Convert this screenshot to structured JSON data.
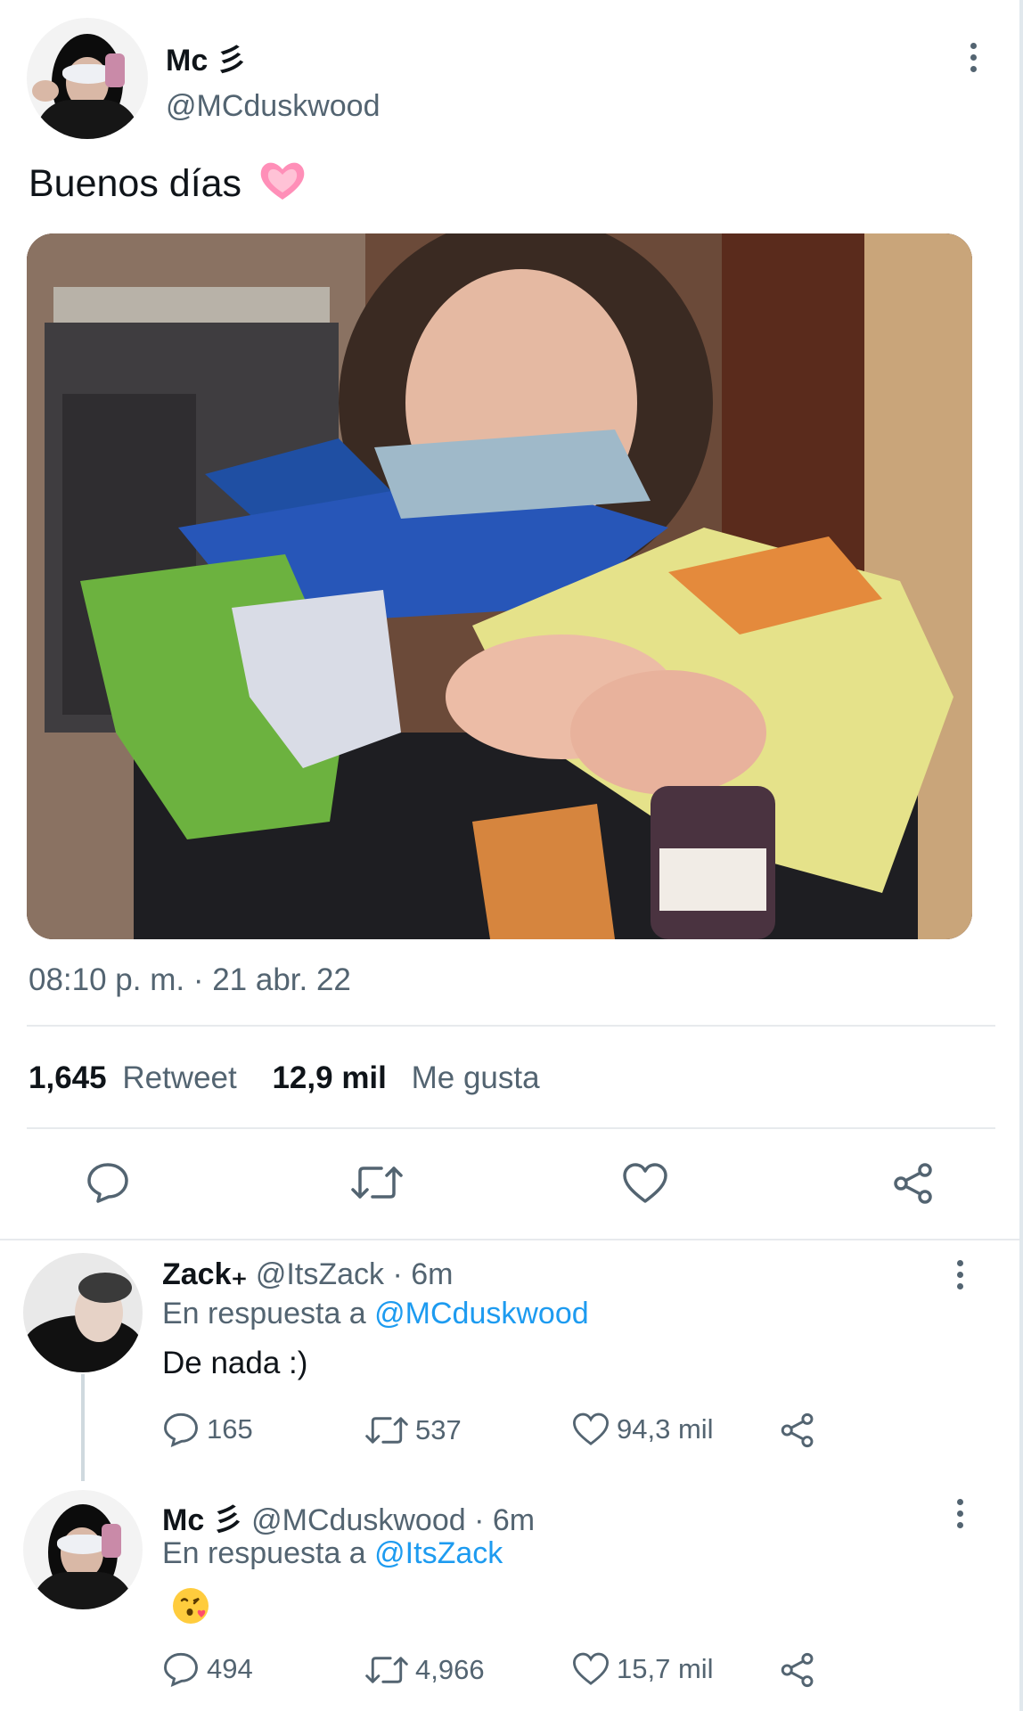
{
  "tweet": {
    "author_name": "Mc",
    "author_symbol": "彡",
    "author_handle": "@MCduskwood",
    "text": "Buenos días",
    "timestamp": "08:10 p. m. · 21 abr. 22",
    "retweet_count": "1,645",
    "retweet_label": "Retweet",
    "like_count": "12,9 mil",
    "like_label": "Me gusta"
  },
  "replies": [
    {
      "name": "Zack",
      "name_suffix": "₊",
      "handle": "@ItsZack",
      "time": "· 6m",
      "in_reply_label": "En respuesta a",
      "in_reply_to": "@MCduskwood",
      "text": "De nada :)",
      "reply_count": "165",
      "retweet_count": "537",
      "like_count": "94,3 mil"
    },
    {
      "name": "Mc",
      "name_suffix": "彡",
      "handle": "@MCduskwood",
      "time": "· 6m",
      "in_reply_label": "En respuesta a",
      "in_reply_to": "@ItsZack",
      "text": "😘",
      "reply_count": "494",
      "retweet_count": "4,966",
      "like_count": "15,7 mil"
    }
  ],
  "icons": {
    "reply": "reply-icon",
    "retweet": "retweet-icon",
    "like": "heart-icon",
    "share": "share-icon",
    "more": "more-options-icon"
  },
  "colors": {
    "link": "#1d9bf0",
    "muted": "#536471",
    "heart_emoji": "#ff8fb8"
  }
}
